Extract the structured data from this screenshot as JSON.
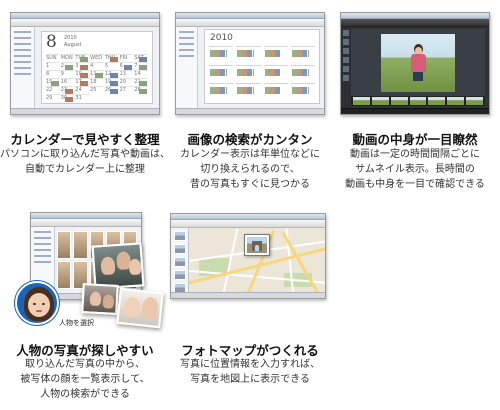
{
  "features": [
    {
      "title": "カレンダーで見やすく整理",
      "desc": [
        "パソコンに取り込んだ写真や動画は、",
        "自動でカレンダー上に整理"
      ],
      "screen": {
        "big_date": "8",
        "year": "2010",
        "month": "August"
      }
    },
    {
      "title": "画像の検索がカンタン",
      "desc": [
        "カレンダー表示は年単位などに",
        "切り換えられるので、",
        "昔の写真もすぐに見つかる"
      ],
      "screen": {
        "year": "2010"
      }
    },
    {
      "title": "動画の中身が一目瞭然",
      "desc": [
        "動画は一定の時間間隔ごとに",
        "サムネイル表示。長時間の",
        "動画も中身を一目で確認できる"
      ]
    },
    {
      "title": "人物の写真が探しやすい",
      "desc": [
        "取り込んだ写真の中から、",
        "被写体の顔を一覧表示して、",
        "人物の検索ができる"
      ],
      "screen": {
        "face_label": "人物を選択"
      }
    },
    {
      "title": "フォトマップがつくれる",
      "desc": [
        "写真に位置情報を入力すれば、",
        "写真を地図上に表示できる"
      ]
    }
  ],
  "calendar_cells": [
    "SUN",
    "MON",
    "TUE",
    "WED",
    "THU",
    "FRI",
    "SAT",
    "1",
    "2",
    "3",
    "4",
    "5",
    "6",
    "7",
    "8",
    "9",
    "10",
    "11",
    "12",
    "13",
    "14",
    "15",
    "16",
    "17",
    "18",
    "19",
    "20",
    "21",
    "22",
    "23",
    "24",
    "25",
    "26",
    "27",
    "28",
    "29",
    "30",
    "31"
  ]
}
